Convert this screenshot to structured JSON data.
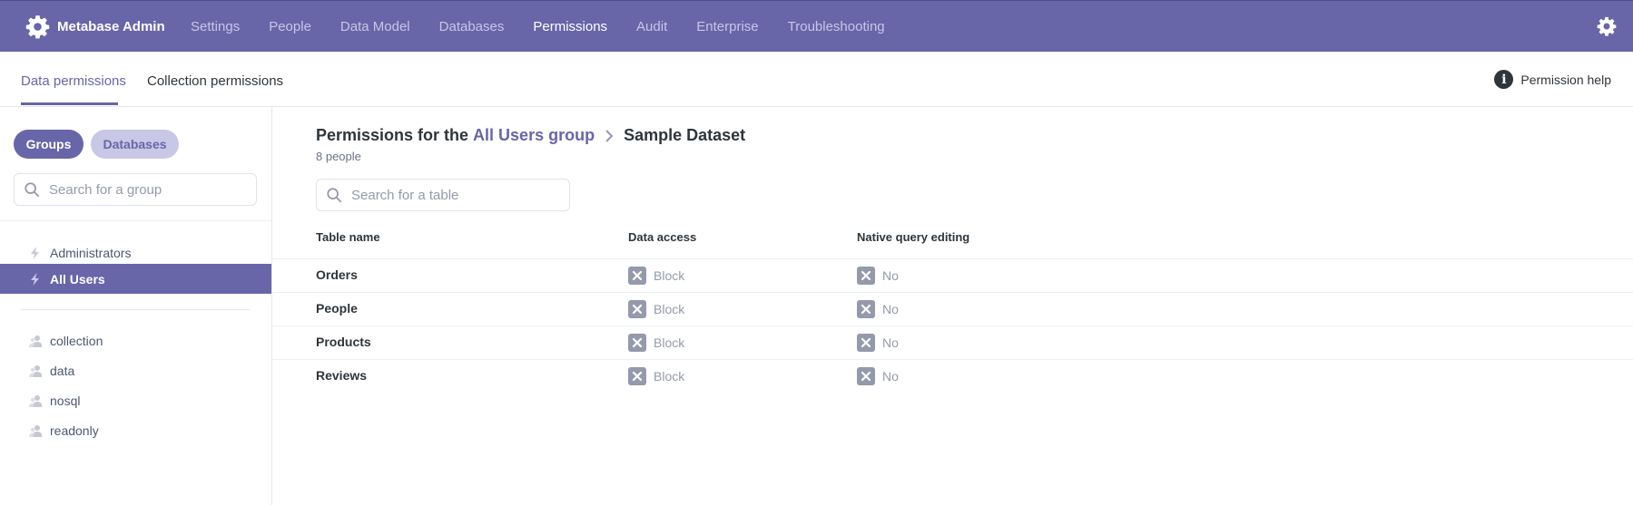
{
  "nav": {
    "brand": "Metabase Admin",
    "items": [
      "Settings",
      "People",
      "Data Model",
      "Databases",
      "Permissions",
      "Audit",
      "Enterprise",
      "Troubleshooting"
    ],
    "active": "Permissions"
  },
  "subtabs": {
    "data": "Data permissions",
    "collection": "Collection permissions",
    "help": "Permission help"
  },
  "sidebar": {
    "groups_label": "Groups",
    "databases_label": "Databases",
    "search_placeholder": "Search for a group",
    "special_groups": [
      "Administrators",
      "All Users"
    ],
    "selected": "All Users",
    "groups": [
      "collection",
      "data",
      "nosql",
      "readonly"
    ]
  },
  "main": {
    "title_prefix": "Permissions for the",
    "title_group": "All Users group",
    "title_db": "Sample Dataset",
    "subtitle": "8 people",
    "table_search_placeholder": "Search for a table",
    "columns": [
      "Table name",
      "Data access",
      "Native query editing"
    ],
    "rows": [
      {
        "name": "Orders",
        "data_access": "Block",
        "native": "No"
      },
      {
        "name": "People",
        "data_access": "Block",
        "native": "No"
      },
      {
        "name": "Products",
        "data_access": "Block",
        "native": "No"
      },
      {
        "name": "Reviews",
        "data_access": "Block",
        "native": "No"
      }
    ]
  },
  "colors": {
    "brand": "#6865a9",
    "brand_light": "#c8c7e6",
    "muted": "#949aab",
    "text_dark": "#2e353b"
  }
}
